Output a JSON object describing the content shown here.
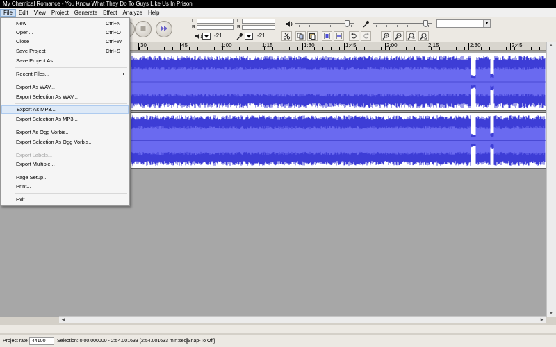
{
  "window": {
    "title": "My Chemical Romance - You Know What They Do To Guys Like Us In Prison"
  },
  "menubar": {
    "items": [
      "File",
      "Edit",
      "View",
      "Project",
      "Generate",
      "Effect",
      "Analyze",
      "Help"
    ]
  },
  "file_menu": {
    "items": [
      {
        "label": "New",
        "shortcut": "Ctrl+N"
      },
      {
        "label": "Open...",
        "shortcut": "Ctrl+O"
      },
      {
        "label": "Close",
        "shortcut": "Ctrl+W"
      },
      {
        "label": "Save Project",
        "shortcut": "Ctrl+S"
      },
      {
        "label": "Save Project As...",
        "shortcut": ""
      },
      {
        "label": "Recent Files...",
        "shortcut": "",
        "submenu_glyph": "▸"
      },
      {
        "label": "Export As WAV...",
        "shortcut": ""
      },
      {
        "label": "Export Selection As WAV...",
        "shortcut": ""
      },
      {
        "label": "Export As MP3...",
        "shortcut": "",
        "highlighted": true
      },
      {
        "label": "Export Selection As MP3...",
        "shortcut": ""
      },
      {
        "label": "Export As Ogg Vorbis...",
        "shortcut": ""
      },
      {
        "label": "Export Selection As Ogg Vorbis...",
        "shortcut": ""
      },
      {
        "label": "Export Labels...",
        "shortcut": "",
        "disabled": true
      },
      {
        "label": "Export Multiple...",
        "shortcut": ""
      },
      {
        "label": "Page Setup...",
        "shortcut": ""
      },
      {
        "label": "Print...",
        "shortcut": ""
      },
      {
        "label": "Exit",
        "shortcut": ""
      }
    ]
  },
  "meters": {
    "left_label": "L",
    "right_label": "R",
    "playback_value": "-21",
    "record_value": "-21"
  },
  "ruler": {
    "labels": [
      "30",
      "45",
      "1:00",
      "1:15",
      "1:30",
      "1:45",
      "2:00",
      "2:15",
      "2:30",
      "2:45"
    ]
  },
  "statusbar": {
    "project_rate_label": "Project rate:",
    "project_rate_value": "44100",
    "selection": "Selection: 0:00.000000 - 2:54.001633 (2:54.001633 min:sec)",
    "snap": "[Snap-To Off]"
  },
  "colors": {
    "waveform": "#3d3dd6",
    "waveform_rms": "#6a6af0",
    "track_bg": "#ffffff",
    "workspace": "#a7a7a7"
  },
  "icons": {
    "pause": "pause-icon",
    "play": "play-icon",
    "stop": "stop-icon",
    "fast_forward": "fast-forward-icon",
    "speaker": "speaker-icon",
    "microphone": "microphone-icon"
  }
}
